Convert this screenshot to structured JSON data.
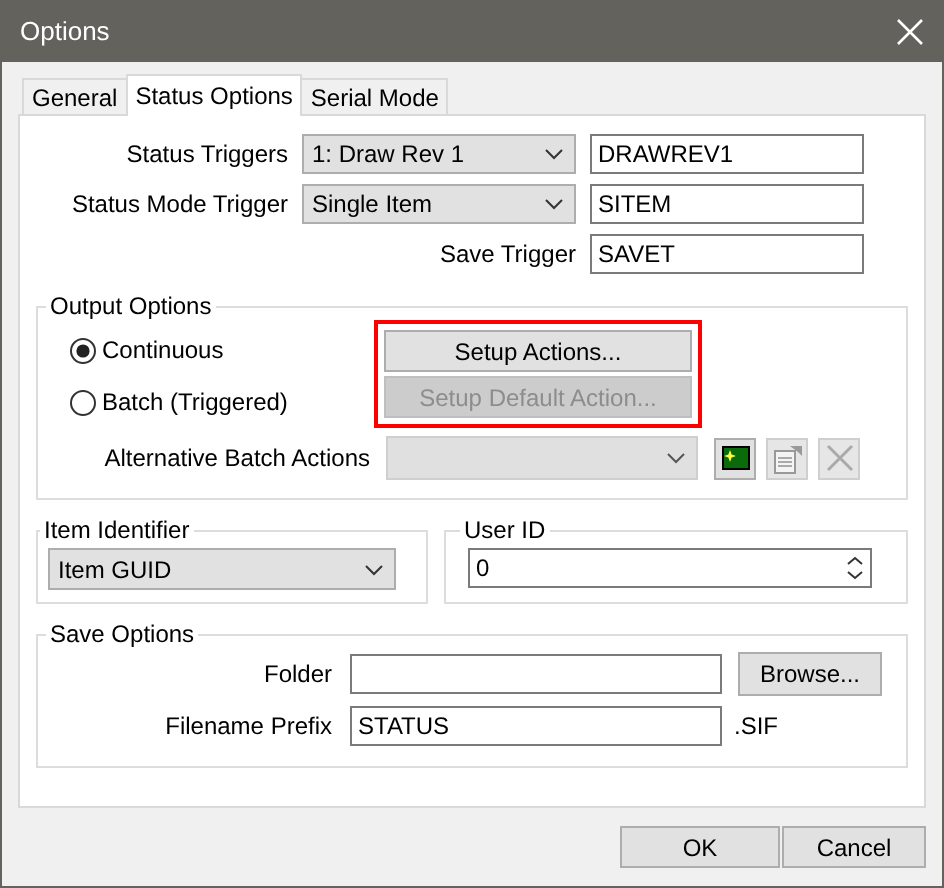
{
  "window": {
    "title": "Options"
  },
  "tabs": [
    {
      "label": "General",
      "selected": false
    },
    {
      "label": "Status Options",
      "selected": true
    },
    {
      "label": "Serial Mode",
      "selected": false
    }
  ],
  "status_triggers": {
    "label": "Status Triggers",
    "dropdown": "1: Draw Rev 1",
    "field": "DRAWREV1"
  },
  "status_mode_trigger": {
    "label": "Status Mode Trigger",
    "dropdown": "Single Item",
    "field": "SITEM"
  },
  "save_trigger": {
    "label": "Save Trigger",
    "field": "SAVET"
  },
  "output_options": {
    "title": "Output Options",
    "radios": [
      {
        "label": "Continuous",
        "selected": true
      },
      {
        "label": "Batch (Triggered)",
        "selected": false
      }
    ],
    "actions_highlighted": true,
    "action_buttons": [
      {
        "label": "Setup Actions...",
        "disabled": false
      },
      {
        "label": "Setup Default Action...",
        "disabled": true
      }
    ],
    "alternative_batch_actions": {
      "label": "Alternative Batch Actions",
      "disabled": true
    },
    "tool_buttons": [
      {
        "kind": "new",
        "disabled": false
      },
      {
        "kind": "edit",
        "disabled": true
      },
      {
        "kind": "delete",
        "disabled": true
      }
    ]
  },
  "item_identifier": {
    "title": "Item Identifier",
    "dropdown": "Item GUID"
  },
  "user_id": {
    "title": "User ID",
    "value": "0"
  },
  "save_options": {
    "title": "Save Options",
    "folder_label": "Folder",
    "folder_button": "Browse...",
    "prefix_label": "Filename Prefix",
    "prefix_value": "STATUS",
    "extension": ".SIF"
  },
  "buttons": [
    "OK",
    "Cancel"
  ]
}
